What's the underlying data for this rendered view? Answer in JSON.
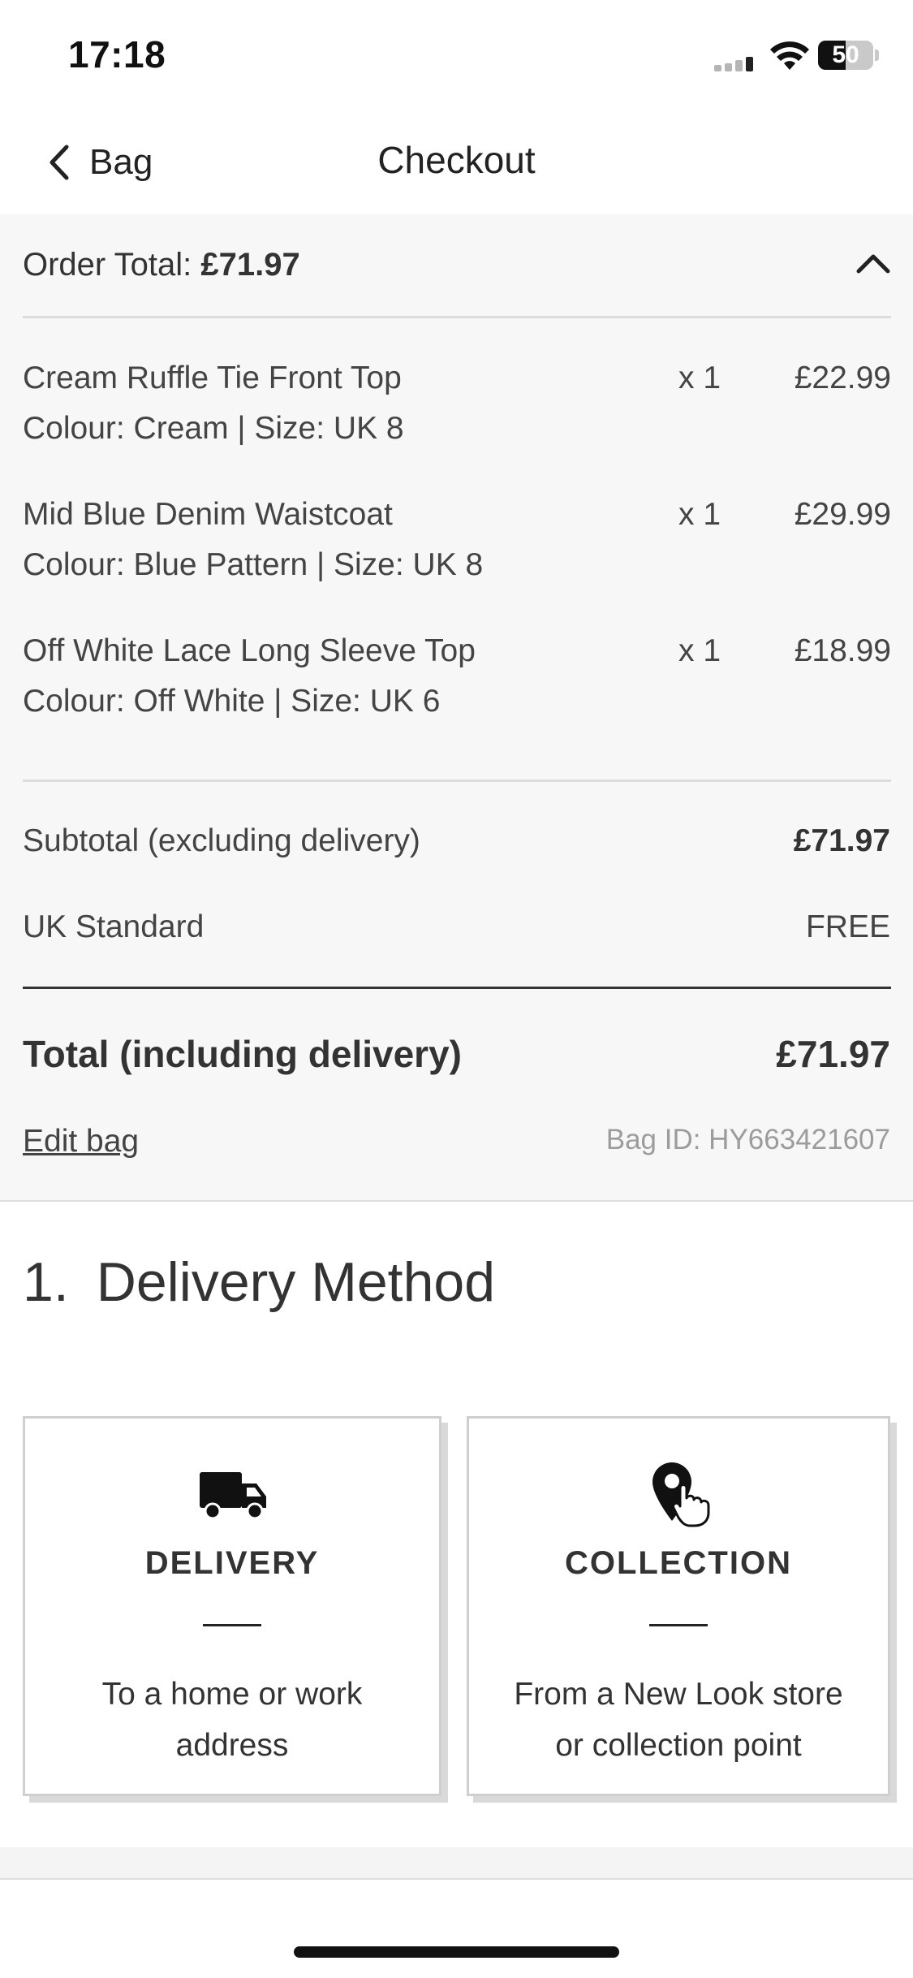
{
  "status_bar": {
    "time": "17:18",
    "battery": "50",
    "battery_level": 0.5
  },
  "nav": {
    "back_label": "Bag",
    "title": "Checkout"
  },
  "summary": {
    "order_total_label": "Order Total:",
    "order_total_value": "£71.97",
    "items": [
      {
        "name": "Cream Ruffle Tie Front Top",
        "variant": "Colour: Cream | Size: UK 8",
        "qty": "x 1",
        "price": "£22.99"
      },
      {
        "name": "Mid Blue Denim Waistcoat",
        "variant": "Colour: Blue Pattern | Size: UK 8",
        "qty": "x 1",
        "price": "£29.99"
      },
      {
        "name": "Off White Lace Long Sleeve Top",
        "variant": "Colour: Off White | Size: UK 6",
        "qty": "x 1",
        "price": "£18.99"
      }
    ],
    "subtotal_label": "Subtotal (excluding delivery)",
    "subtotal_value": "£71.97",
    "shipping_label": "UK Standard",
    "shipping_value": "FREE",
    "total_label": "Total (including delivery)",
    "total_value": "£71.97",
    "edit_bag": "Edit bag",
    "bag_id": "Bag ID: HY663421607"
  },
  "delivery_method": {
    "number": "1.",
    "title": "Delivery Method",
    "options": [
      {
        "title": "DELIVERY",
        "desc_line1": "To a home or work",
        "desc_line2": "address",
        "icon": "truck-icon"
      },
      {
        "title": "COLLECTION",
        "desc_line1": "From a New Look store",
        "desc_line2": "or collection point",
        "icon": "location-pin-hand-icon"
      }
    ]
  }
}
